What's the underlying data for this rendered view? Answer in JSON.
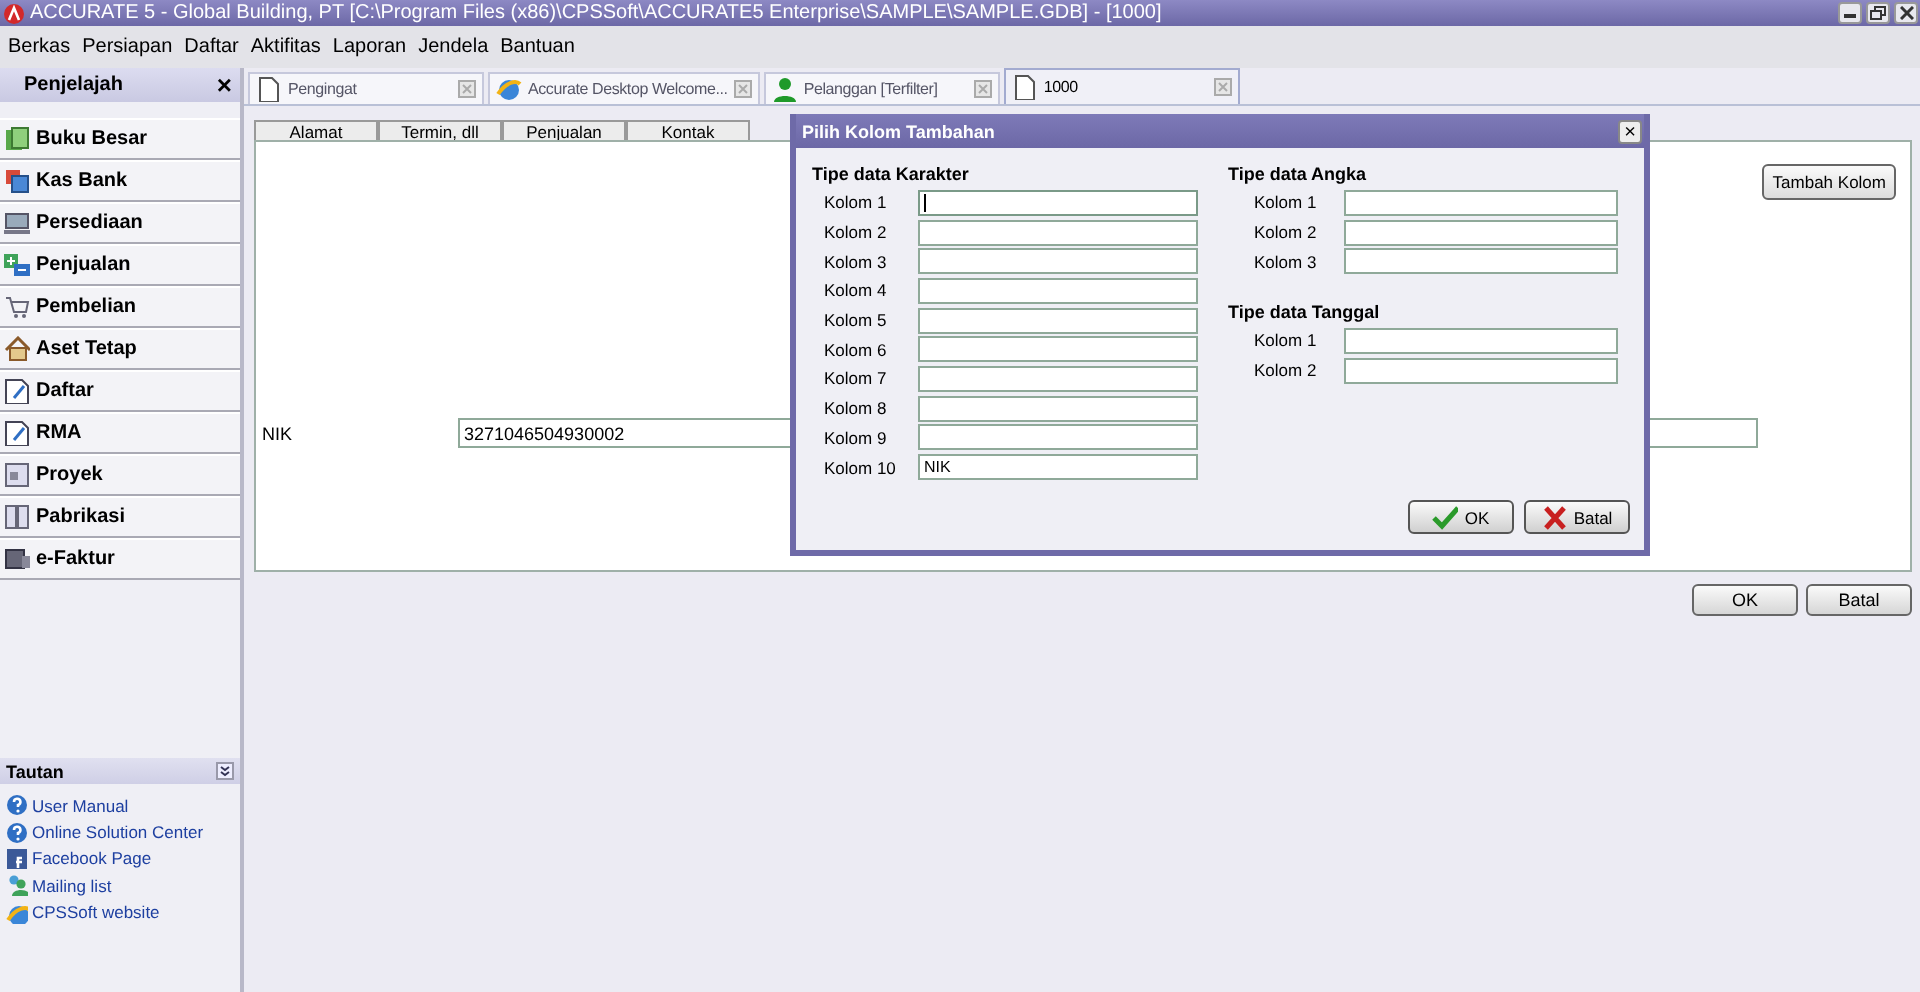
{
  "window": {
    "title": "ACCURATE 5  - Global Building, PT  [C:\\Program Files (x86)\\CPSSoft\\ACCURATE5 Enterprise\\SAMPLE\\SAMPLE.GDB] - [1000]"
  },
  "menu": [
    "Berkas",
    "Persiapan",
    "Daftar",
    "Aktifitas",
    "Laporan",
    "Jendela",
    "Bantuan"
  ],
  "sidebar": {
    "title": "Penjelajah",
    "close": "×",
    "items": [
      {
        "label": "Buku Besar"
      },
      {
        "label": "Kas Bank"
      },
      {
        "label": "Persediaan"
      },
      {
        "label": "Penjualan"
      },
      {
        "label": "Pembelian"
      },
      {
        "label": "Aset Tetap"
      },
      {
        "label": "Daftar"
      },
      {
        "label": "RMA"
      },
      {
        "label": "Proyek"
      },
      {
        "label": "Pabrikasi"
      },
      {
        "label": "e-Faktur"
      }
    ]
  },
  "links": {
    "title": "Tautan",
    "items": [
      {
        "label": "User Manual",
        "kind": "help"
      },
      {
        "label": "Online Solution Center",
        "kind": "help"
      },
      {
        "label": "Facebook Page",
        "kind": "facebook"
      },
      {
        "label": "Mailing list",
        "kind": "people"
      },
      {
        "label": "CPSSoft website",
        "kind": "web"
      }
    ]
  },
  "doc_tabs": [
    {
      "label": "Pengingat",
      "kind": "page",
      "selected": false
    },
    {
      "label": "Accurate Desktop Welcome...",
      "kind": "web",
      "selected": false
    },
    {
      "label": "Pelanggan [Terfilter]",
      "kind": "person",
      "selected": false
    },
    {
      "label": "1000",
      "kind": "page",
      "selected": true
    }
  ],
  "form": {
    "tabs": [
      {
        "label": "Alamat",
        "selected": false
      },
      {
        "label": "Termin, dll",
        "selected": false
      },
      {
        "label": "Penjualan",
        "selected": false
      },
      {
        "label": "Kontak",
        "selected": false
      }
    ],
    "add_column_button": "Tambah Kolom",
    "nik_label": "NIK",
    "nik_value": "3271046504930002"
  },
  "buttons": [
    "OK",
    "Batal"
  ],
  "dialog": {
    "title": "Pilih Kolom Tambahan",
    "close": "×",
    "groups": [
      {
        "title": "Tipe data Karakter",
        "fields": [
          {
            "label": "Kolom 1",
            "focused": true
          },
          {
            "label": "Kolom 2",
            "focused": false
          },
          {
            "label": "Kolom 3",
            "focused": false
          },
          {
            "label": "Kolom 4",
            "focused": false
          },
          {
            "label": "Kolom 5",
            "focused": false
          },
          {
            "label": "Kolom 6",
            "focused": false
          },
          {
            "label": "Kolom 7",
            "focused": false
          },
          {
            "label": "Kolom 8",
            "focused": false
          },
          {
            "label": "Kolom 9",
            "focused": false
          },
          {
            "label": "Kolom 10",
            "value": "NIK",
            "focused": false
          }
        ]
      },
      {
        "title": "Tipe data Angka",
        "fields": [
          {
            "label": "Kolom 1",
            "focused": false
          },
          {
            "label": "Kolom 2",
            "focused": false
          },
          {
            "label": "Kolom 3",
            "focused": false
          }
        ]
      },
      {
        "title": "Tipe data Tanggal",
        "fields": [
          {
            "label": "Kolom 1",
            "focused": false
          },
          {
            "label": "Kolom 2",
            "focused": false
          }
        ]
      }
    ],
    "buttons": [
      {
        "label": "OK",
        "kind": "ok"
      },
      {
        "label": "Batal",
        "kind": "cancel"
      }
    ]
  }
}
